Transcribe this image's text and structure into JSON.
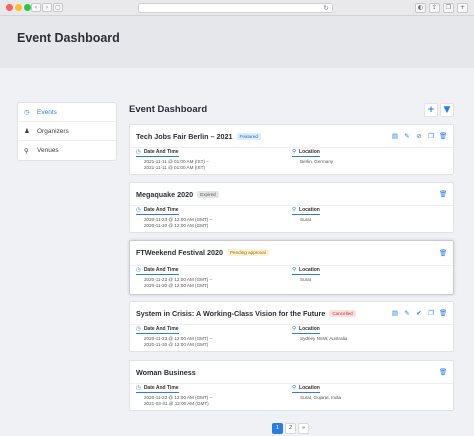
{
  "header": {
    "title": "Event Dashboard"
  },
  "sidebar": {
    "items": [
      {
        "label": "Events",
        "icon": "calendar-icon",
        "active": true
      },
      {
        "label": "Organizers",
        "icon": "person-icon",
        "active": false
      },
      {
        "label": "Venues",
        "icon": "pin-icon",
        "active": false
      }
    ]
  },
  "main": {
    "title": "Event Dashboard",
    "toolbar": {
      "add_icon": "plus-icon",
      "filter_icon": "filter-icon"
    }
  },
  "field_labels": {
    "datetime": "Date And Time",
    "location": "Location"
  },
  "events": [
    {
      "title": "Tech Jobs Fair Berlin – 2021",
      "badge": "Featured",
      "datetime_start": "2021-11-11 @ 01:00 AM (IST) –",
      "datetime_end": "2021-11-11 @ 01:00 AM (IST)",
      "location": "Berlin, Germany"
    },
    {
      "title": "Megaquake 2020",
      "badge": "Expired",
      "datetime_start": "2020-11-23 @ 12:00 AM (GMT) –",
      "datetime_end": "2020-11-30 @ 12:00 AM (GMT)",
      "location": "Surat"
    },
    {
      "title": "FTWeekend Festival 2020",
      "badge": "Pending approval",
      "datetime_start": "2020-11-23 @ 12:00 AM (GMT) –",
      "datetime_end": "2020-11-30 @ 12:00 AM (GMT)",
      "location": "Surat"
    },
    {
      "title": "System in Crisis: A Working-Class Vision for the Future",
      "badge": "Cancelled",
      "datetime_start": "2020-11-23 @ 12:00 AM (GMT) –",
      "datetime_end": "2020-11-30 @ 12:00 AM (GMT)",
      "location": "Sydney NSW, Australia"
    },
    {
      "title": "Woman Business",
      "badge": "",
      "datetime_start": "2020-11-23 @ 12:00 AM (GMT) –",
      "datetime_end": "2021-03-31 @ 12:00 AM (GMT)",
      "location": "Surat, Gujarat, India"
    }
  ],
  "pagination": {
    "pages": [
      "1",
      "2"
    ],
    "current": "1",
    "next": "»"
  },
  "colors": {
    "accent": "#2a7de1",
    "background": "#f0f1f4"
  }
}
